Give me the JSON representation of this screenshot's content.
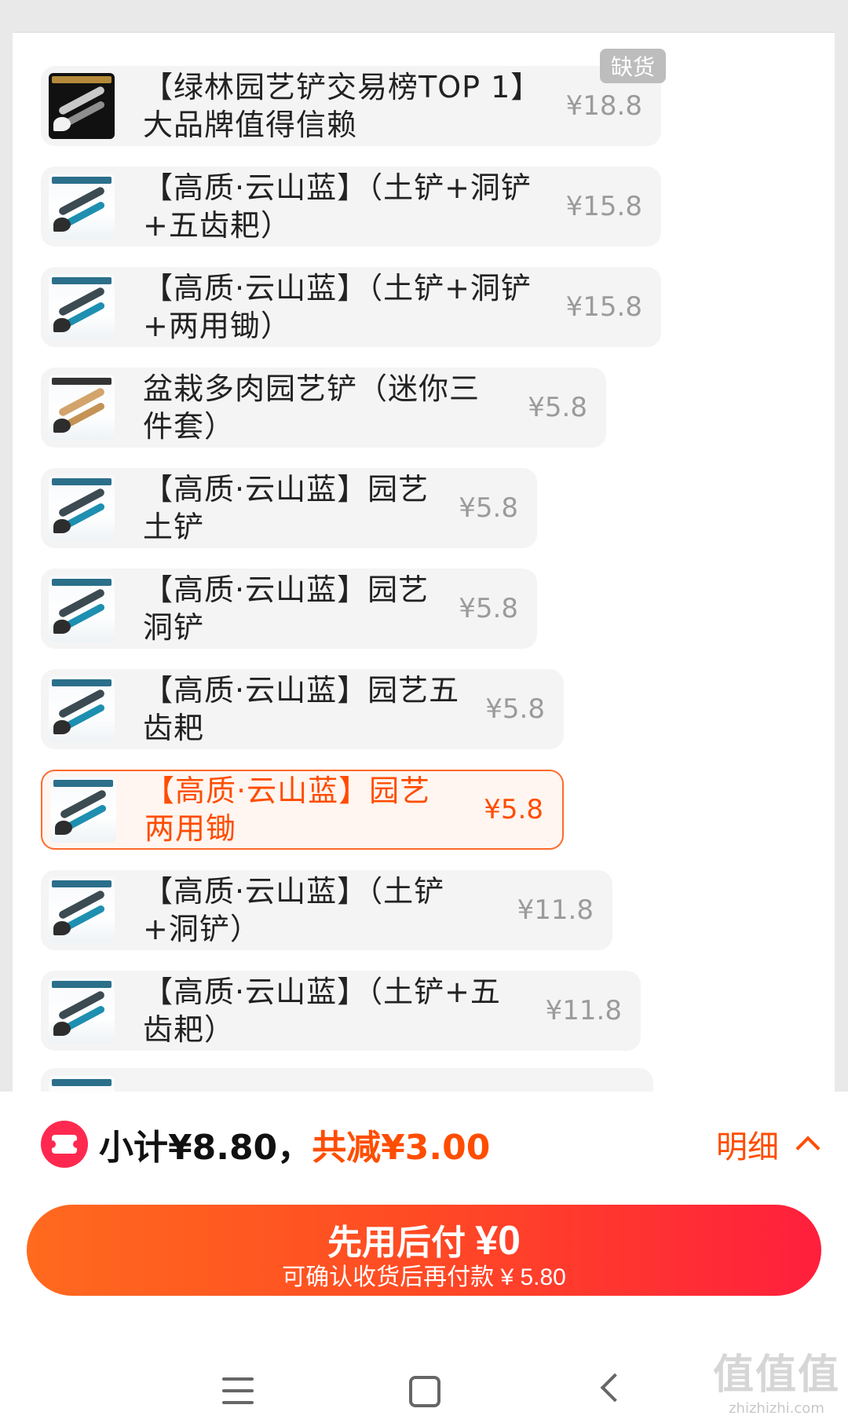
{
  "skus": [
    {
      "name": "【绿林园艺铲交易榜TOP 1】大品牌值得信赖",
      "price": "¥18.8",
      "badge": "缺货"
    },
    {
      "name": "【高质·云山蓝】（土铲+洞铲+五齿耙）",
      "price": "¥15.8"
    },
    {
      "name": "【高质·云山蓝】（土铲+洞铲+两用锄）",
      "price": "¥15.8"
    },
    {
      "name": "盆栽多肉园艺铲（迷你三件套）",
      "price": "¥5.8"
    },
    {
      "name": "【高质·云山蓝】园艺土铲",
      "price": "¥5.8"
    },
    {
      "name": "【高质·云山蓝】园艺洞铲",
      "price": "¥5.8"
    },
    {
      "name": "【高质·云山蓝】园艺五齿耙",
      "price": "¥5.8"
    },
    {
      "name": "【高质·云山蓝】园艺两用锄",
      "price": "¥5.8",
      "selected": true
    },
    {
      "name": "【高质·云山蓝】（土铲+洞铲）",
      "price": "¥11.8"
    },
    {
      "name": "【高质·云山蓝】（土铲+五齿耙）",
      "price": "¥11.8"
    }
  ],
  "summary": {
    "subtotal": "小计¥8.80，",
    "discount": "共减¥3.00",
    "detail": "明细"
  },
  "pay": {
    "title": "先用后付 ",
    "amount": "¥0",
    "subtitle": "可确认收货后再付款 ¥ 5.80"
  },
  "watermark": {
    "big": "值值值",
    "small": "zhizhizhi.com"
  },
  "colors": {
    "accent": "#ff4d00",
    "gradient_start": "#ff6a1e",
    "gradient_end": "#ff1f3d",
    "coupon": "#ff2950"
  }
}
